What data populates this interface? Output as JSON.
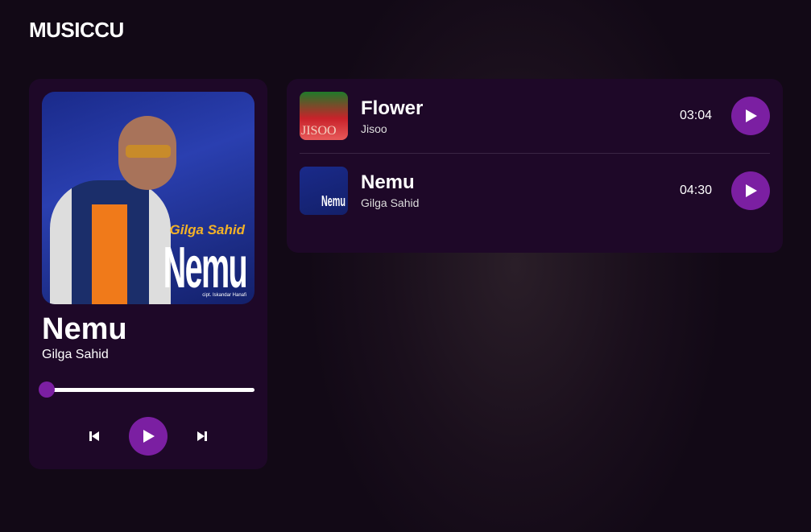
{
  "app": {
    "title": "MUSICCU"
  },
  "now_playing": {
    "title": "Nemu",
    "artist": "Gilga Sahid",
    "progress_percent": 0,
    "cover_text": {
      "artist": "Gilga Sahid",
      "title": "Nemu",
      "credit": "cipt. Iskandar Hanafi"
    }
  },
  "colors": {
    "accent": "#7b1fa2",
    "card": "#1e0828",
    "background": "#120916"
  },
  "playlist": [
    {
      "title": "Flower",
      "artist": "Jisoo",
      "duration": "03:04",
      "thumb_text": "JISOO"
    },
    {
      "title": "Nemu",
      "artist": "Gilga Sahid",
      "duration": "04:30",
      "thumb_text": "Nemu"
    }
  ]
}
